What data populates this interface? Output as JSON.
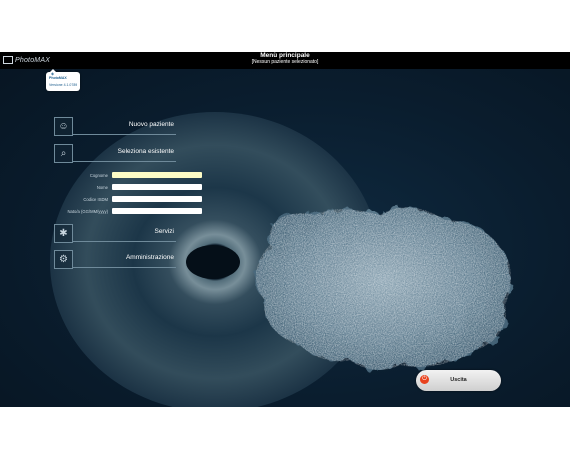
{
  "header": {
    "logo_text": "PhotoMAX",
    "title": "Menù principale",
    "subtitle": "[Nessun paziente selezionato]"
  },
  "tooltip": {
    "app_name": "PhotoMAX",
    "version": "Versione 4.1.0789"
  },
  "menu": {
    "new_patient": "Nuovo paziente",
    "select_existing": "Seleziona esistente",
    "services": "Servizi",
    "administration": "Amministrazione"
  },
  "search_form": {
    "surname_label": "Cognome",
    "name_label": "Nome",
    "isdm_label": "Codice ISDM",
    "dob_label": "Nato/a (GG/MM/yyyy)",
    "surname_value": "",
    "name_value": "",
    "isdm_value": "",
    "dob_value": ""
  },
  "exit_button": {
    "label": "Uscita"
  },
  "colors": {
    "background": "#0a1d2e",
    "topbar": "#000000",
    "highlight_field": "#fdfcc6",
    "exit_icon": "#e8421e"
  },
  "icons": {
    "new_patient": "add-patient-icon",
    "select_existing": "magnifier-icon",
    "services": "spiral-icon",
    "administration": "gear-hand-icon",
    "exit": "power-icon"
  }
}
